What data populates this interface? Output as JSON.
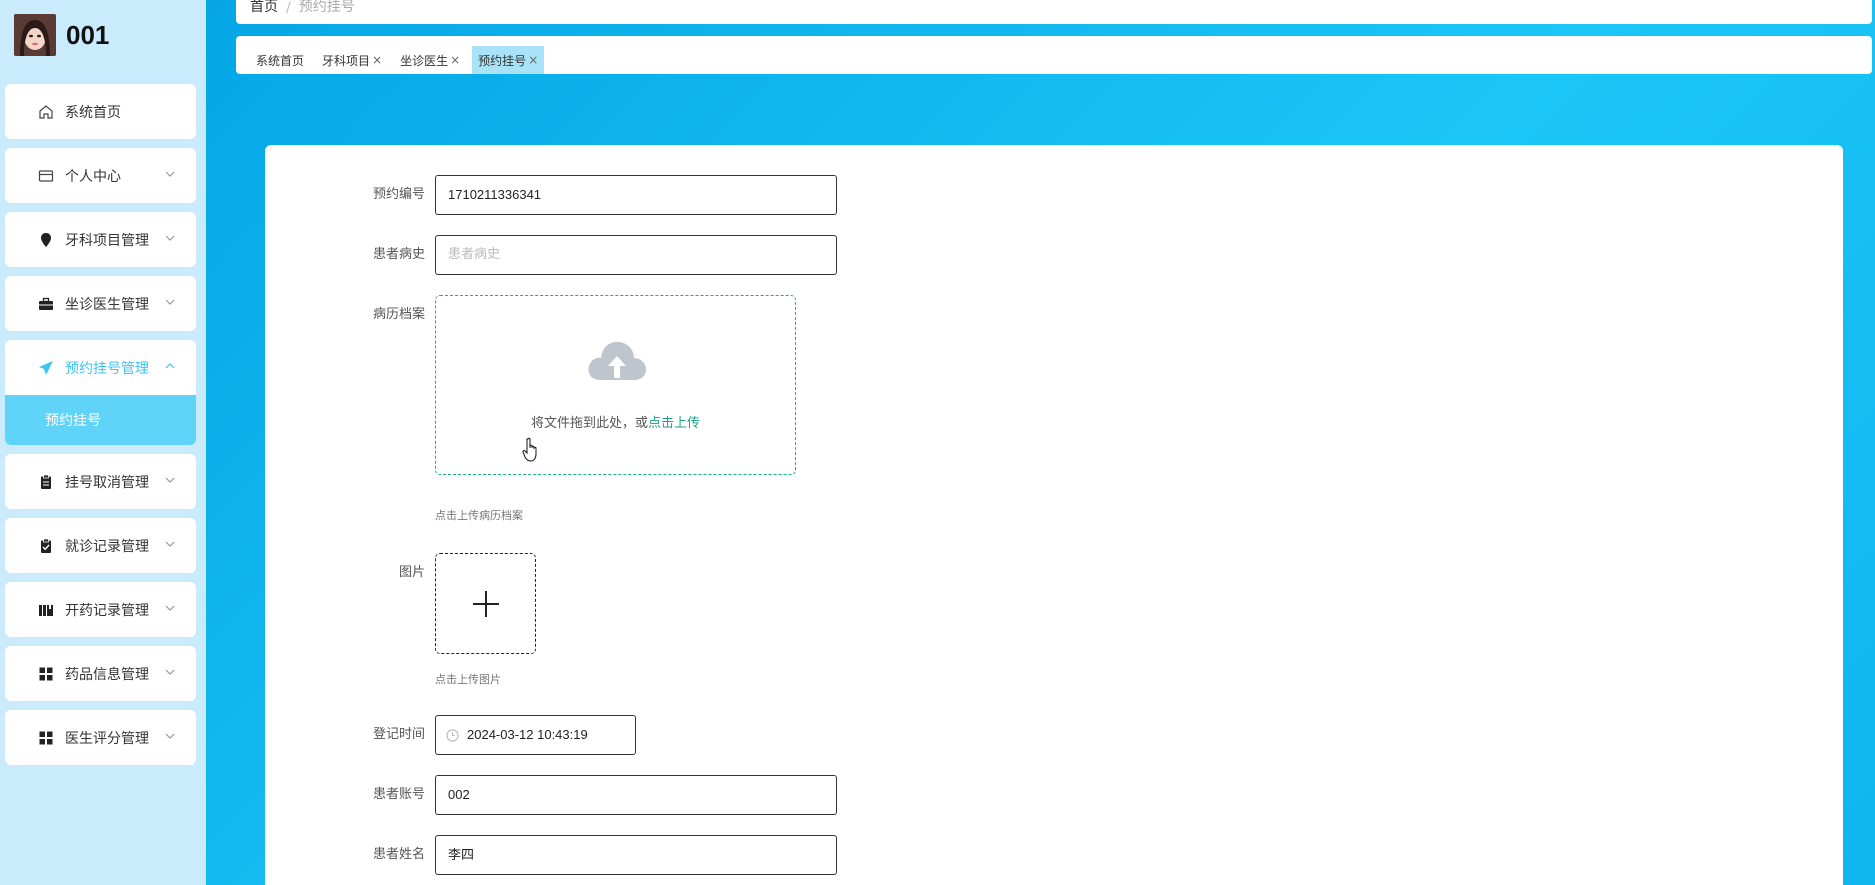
{
  "profile": {
    "name": "001"
  },
  "sidebar": {
    "items": [
      {
        "label": "系统首页",
        "icon": "home-icon",
        "has_chevron": false
      },
      {
        "label": "个人中心",
        "icon": "card-icon",
        "has_chevron": true
      },
      {
        "label": "牙科项目管理",
        "icon": "location-pin-icon",
        "has_chevron": true
      },
      {
        "label": "坐诊医生管理",
        "icon": "briefcase-icon",
        "has_chevron": true
      }
    ],
    "active_group": {
      "label": "预约挂号管理",
      "icon": "paper-plane-icon",
      "submenu": [
        "预约挂号"
      ]
    },
    "items_after": [
      {
        "label": "挂号取消管理",
        "icon": "clipboard-icon"
      },
      {
        "label": "就诊记录管理",
        "icon": "clipboard-check-icon"
      },
      {
        "label": "开药记录管理",
        "icon": "books-icon"
      },
      {
        "label": "药品信息管理",
        "icon": "grid-icon"
      },
      {
        "label": "医生评分管理",
        "icon": "grid-icon"
      }
    ]
  },
  "breadcrumb": {
    "home": "首页",
    "current": "预约挂号"
  },
  "tabs": [
    {
      "label": "系统首页",
      "closable": false,
      "active": false
    },
    {
      "label": "牙科项目",
      "closable": true,
      "active": false
    },
    {
      "label": "坐诊医生",
      "closable": true,
      "active": false
    },
    {
      "label": "预约挂号",
      "closable": true,
      "active": true
    }
  ],
  "form": {
    "booking_no": {
      "label": "预约编号",
      "value": "1710211336341"
    },
    "history": {
      "label": "患者病史",
      "placeholder": "患者病史"
    },
    "records": {
      "label": "病历档案",
      "upload_text": "将文件拖到此处，或",
      "upload_link": "点击上传",
      "hint": "点击上传病历档案"
    },
    "picture": {
      "label": "图片",
      "hint": "点击上传图片"
    },
    "register_time": {
      "label": "登记时间",
      "value": "2024-03-12 10:43:19"
    },
    "patient_account": {
      "label": "患者账号",
      "value": "002"
    },
    "patient_name": {
      "label": "患者姓名",
      "value": "李四"
    }
  },
  "colors": {
    "accent": "#3fc4f1",
    "upload_link": "#1aa58a",
    "active_tab": "#a9e3f7"
  }
}
